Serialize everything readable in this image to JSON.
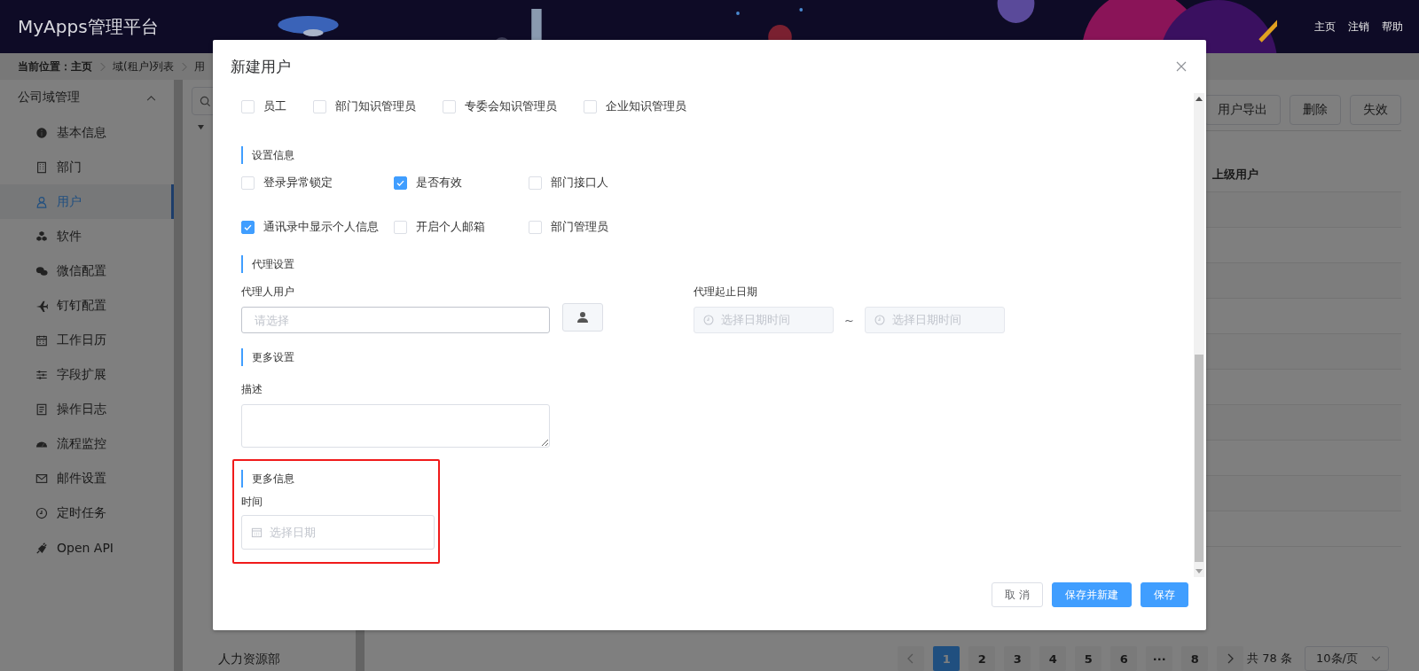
{
  "header": {
    "title": "MyApps管理平台",
    "nav": [
      "主页",
      "注销",
      "帮助"
    ]
  },
  "breadcrumb": {
    "label": "当前位置：",
    "items": [
      "主页",
      "域(租户)列表",
      "用"
    ]
  },
  "sidebar": {
    "group": "公司域管理",
    "expanded": true,
    "items": [
      {
        "label": "基本信息",
        "selected": false
      },
      {
        "label": "部门",
        "selected": false
      },
      {
        "label": "用户",
        "selected": true
      },
      {
        "label": "软件",
        "selected": false
      },
      {
        "label": "微信配置",
        "selected": false
      },
      {
        "label": "钉钉配置",
        "selected": false
      },
      {
        "label": "工作日历",
        "selected": false
      },
      {
        "label": "字段扩展",
        "selected": false
      },
      {
        "label": "操作日志",
        "selected": false
      },
      {
        "label": "流程监控",
        "selected": false
      },
      {
        "label": "邮件设置",
        "selected": false
      },
      {
        "label": "定时任务",
        "selected": false
      },
      {
        "label": "Open API",
        "selected": false
      }
    ]
  },
  "tree": {
    "items": [
      "人力资源部"
    ]
  },
  "toolbar": {
    "buttons": [
      "用户导出",
      "删除",
      "失效"
    ]
  },
  "table": {
    "columns": [
      "上级用户"
    ]
  },
  "pagination": {
    "pages": [
      {
        "label": "1",
        "selected": true
      },
      {
        "label": "2",
        "selected": false
      },
      {
        "label": "3",
        "selected": false
      },
      {
        "label": "4",
        "selected": false
      },
      {
        "label": "5",
        "selected": false
      },
      {
        "label": "6",
        "selected": false
      },
      {
        "label": "···",
        "selected": false
      },
      {
        "label": "8",
        "selected": false
      }
    ],
    "total": "共 78 条",
    "page_size": "10条/页"
  },
  "dialog": {
    "title": "新建用户",
    "roles": [
      {
        "label": "员工",
        "checked": false
      },
      {
        "label": "部门知识管理员",
        "checked": false
      },
      {
        "label": "专委会知识管理员",
        "checked": false
      },
      {
        "label": "企业知识管理员",
        "checked": false
      }
    ],
    "settings": {
      "title": "设置信息",
      "rows": [
        [
          {
            "label": "登录异常锁定",
            "checked": false
          },
          {
            "label": "是否有效",
            "checked": true
          },
          {
            "label": "部门接口人",
            "checked": false
          }
        ],
        [
          {
            "label": "通讯录中显示个人信息",
            "checked": true
          },
          {
            "label": "开启个人邮箱",
            "checked": false
          },
          {
            "label": "部门管理员",
            "checked": false
          }
        ]
      ]
    },
    "proxy": {
      "title": "代理设置",
      "user_label": "代理人用户",
      "user_placeholder": "请选择",
      "date_label": "代理起止日期",
      "start_placeholder": "选择日期时间",
      "separator": "~",
      "end_placeholder": "选择日期时间"
    },
    "more_settings": {
      "title": "更多设置",
      "description_label": "描述"
    },
    "more_info": {
      "title": "更多信息",
      "highlighted": true,
      "time_label": "时间",
      "time_placeholder": "选择日期"
    },
    "buttons": [
      {
        "label": "取 消",
        "kind": "default"
      },
      {
        "label": "保存并新建",
        "kind": "primary"
      },
      {
        "label": "保存",
        "kind": "primary"
      }
    ]
  }
}
